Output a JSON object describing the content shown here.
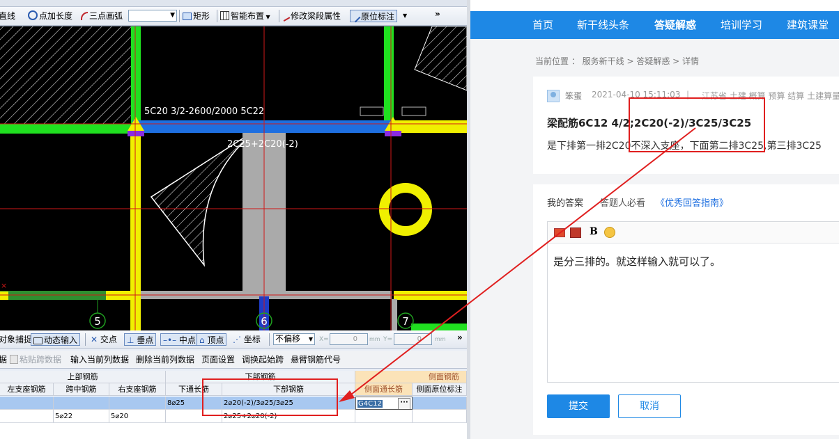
{
  "cad": {
    "toolbar1": {
      "line": "直线",
      "point_length": "点加长度",
      "arc": "三点画弧",
      "rect": "矩形",
      "smart_layout": "智能布置",
      "modify_beam": "修改梁段属性",
      "original_mark": "原位标注"
    },
    "drawing": {
      "beam_label_top": "5C20 3/2-2600/2000  5C22",
      "beam_label_mid": "2C25+2C20(-2)",
      "axis_5": "5",
      "axis_6": "6",
      "axis_7": "7"
    },
    "toolbar2": {
      "object_snap": "对象捕捉",
      "dynamic_input": "动态输入",
      "intersection": "交点",
      "perpendicular": "垂点",
      "midpoint": "中点",
      "vertex": "顶点",
      "coordinate": "坐标",
      "offset_select": "不偏移",
      "x_label": "X=",
      "x_value": "0",
      "y_label": "Y=",
      "y_value": "0",
      "unit": "mm"
    },
    "toolbar3": {
      "partial": "据",
      "paste_span": "粘贴跨数据",
      "input_col": "输入当前列数据",
      "delete_col": "删除当前列数据",
      "page_setup": "页面设置",
      "swap_start": "调换起始跨",
      "cantilever_code": "悬臂钢筋代号"
    },
    "table": {
      "group_top": "上部钢筋",
      "group_bottom": "下部钢筋",
      "group_side": "侧面钢筋",
      "headers": [
        "左支座钢筋",
        "跨中钢筋",
        "右支座钢筋",
        "下通长筋",
        "下部钢筋",
        "侧面通长筋",
        "侧面原位标注"
      ],
      "rows": [
        [
          "",
          "",
          "",
          "8⌀25",
          "2⌀20(-2)/3⌀25/3⌀25",
          "G4C12",
          ""
        ],
        [
          "",
          "5⌀22",
          "5⌀20",
          "",
          "2⌀25+2⌀20(-2)",
          "",
          ""
        ]
      ],
      "ellipsis": "···"
    }
  },
  "web": {
    "nav": [
      "首页",
      "新干线头条",
      "答疑解惑",
      "培训学习",
      "建筑课堂"
    ],
    "breadcrumb": "当前位置 ： 服务新干线 > 答疑解惑 > 详情",
    "question": {
      "user": "笨蛋",
      "time": "2021-04-10 15:11:03",
      "separator": "|",
      "tags": "江苏省  土建  概算  预算  结算  土建算量",
      "title": "梁配筋6C12 4/2;2C20(-2)/3C25/3C25",
      "body": "是下排第一排2C20不深入支座，下面第二排3C25,第三排3C25"
    },
    "answer": {
      "my_answer": "我的答案",
      "must_read": "答题人必看",
      "guide_link": "《优秀回答指南》",
      "editor_bold": "B",
      "text": "是分三排的。就这样输入就可以了。",
      "submit": "提交",
      "cancel": "取消"
    }
  },
  "colors": {
    "nav_blue": "#1e88e5",
    "annotation_red": "#e01f1f",
    "beam_blue": "#1e6fe0"
  }
}
